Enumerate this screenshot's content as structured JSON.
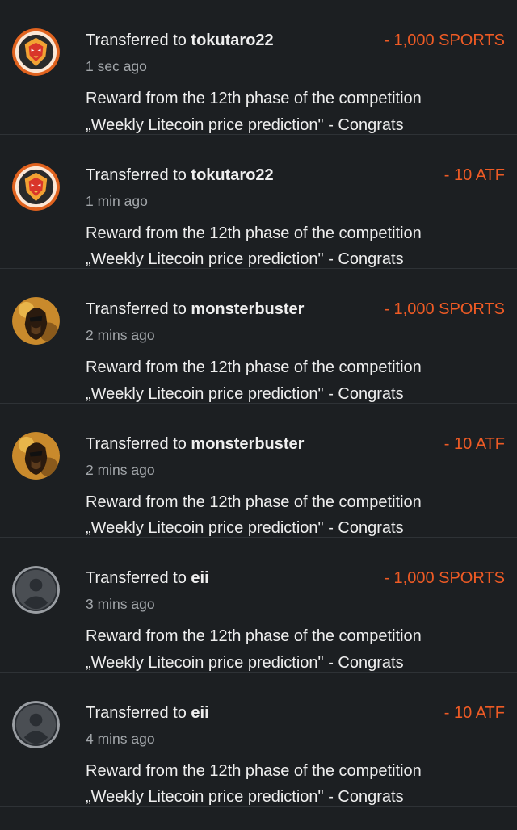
{
  "transfers": [
    {
      "prefix": "Transferred to ",
      "user": "tokutaro22",
      "amount": "- 1,000 SPORTS",
      "time": "1 sec ago",
      "memo_line1": "Reward from the 12th phase of the competition",
      "memo_line2": "„Weekly Litecoin price prediction\" - Congrats",
      "avatar": "lion-avatar-icon"
    },
    {
      "prefix": "Transferred to ",
      "user": "tokutaro22",
      "amount": "- 10 ATF",
      "time": "1 min ago",
      "memo_line1": "Reward from the 12th phase of the competition",
      "memo_line2": "„Weekly Litecoin price prediction\" - Congrats",
      "avatar": "lion-avatar-icon"
    },
    {
      "prefix": "Transferred to ",
      "user": "monsterbuster",
      "amount": "- 1,000 SPORTS",
      "time": "2 mins ago",
      "memo_line1": "Reward from the 12th phase of the competition",
      "memo_line2": "„Weekly Litecoin price prediction\" - Congrats",
      "avatar": "portrait-avatar-icon"
    },
    {
      "prefix": "Transferred to ",
      "user": "monsterbuster",
      "amount": "- 10 ATF",
      "time": "2 mins ago",
      "memo_line1": "Reward from the 12th phase of the competition",
      "memo_line2": "„Weekly Litecoin price prediction\" - Congrats",
      "avatar": "portrait-avatar-icon"
    },
    {
      "prefix": "Transferred to ",
      "user": "eii",
      "amount": "- 1,000 SPORTS",
      "time": "3 mins ago",
      "memo_line1": "Reward from the 12th phase of the competition",
      "memo_line2": "„Weekly Litecoin price prediction\" - Congrats",
      "avatar": "default-user-avatar-icon"
    },
    {
      "prefix": "Transferred to ",
      "user": "eii",
      "amount": "- 10 ATF",
      "time": "4 mins ago",
      "memo_line1": "Reward from the 12th phase of the competition",
      "memo_line2": "„Weekly Litecoin price prediction\" - Congrats",
      "avatar": "default-user-avatar-icon"
    }
  ],
  "colors": {
    "background": "#1c1f22",
    "amount": "#ef5b25",
    "divider": "#2e3236",
    "muted_text": "#a3a7ab"
  }
}
